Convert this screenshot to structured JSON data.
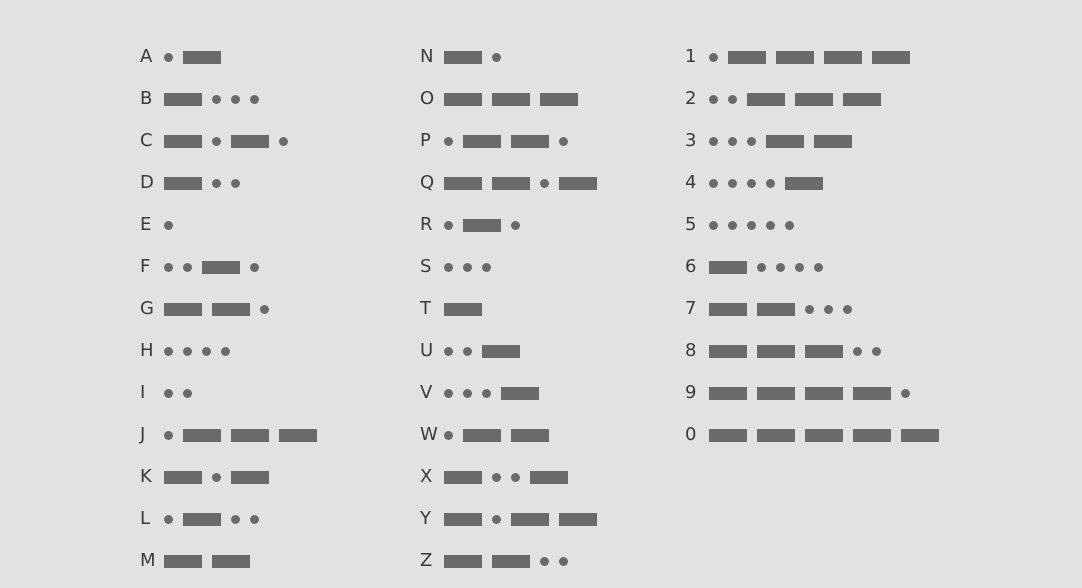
{
  "columns": [
    [
      {
        "char": "A",
        "code": ".-"
      },
      {
        "char": "B",
        "code": "-..."
      },
      {
        "char": "C",
        "code": "-.-."
      },
      {
        "char": "D",
        "code": "-.."
      },
      {
        "char": "E",
        "code": "."
      },
      {
        "char": "F",
        "code": "..-."
      },
      {
        "char": "G",
        "code": "--."
      },
      {
        "char": "H",
        "code": "...."
      },
      {
        "char": "I",
        "code": ".."
      },
      {
        "char": "J",
        "code": ".---"
      },
      {
        "char": "K",
        "code": "-.-"
      },
      {
        "char": "L",
        "code": ".-.."
      },
      {
        "char": "M",
        "code": "--"
      }
    ],
    [
      {
        "char": "N",
        "code": "-."
      },
      {
        "char": "O",
        "code": "---"
      },
      {
        "char": "P",
        "code": ".--."
      },
      {
        "char": "Q",
        "code": "--.-"
      },
      {
        "char": "R",
        "code": ".-."
      },
      {
        "char": "S",
        "code": "..."
      },
      {
        "char": "T",
        "code": "-"
      },
      {
        "char": "U",
        "code": "..-"
      },
      {
        "char": "V",
        "code": "...-"
      },
      {
        "char": "W",
        "code": ".--"
      },
      {
        "char": "X",
        "code": "-..-"
      },
      {
        "char": "Y",
        "code": "-.--"
      },
      {
        "char": "Z",
        "code": "--.."
      }
    ],
    [
      {
        "char": "1",
        "code": ".----"
      },
      {
        "char": "2",
        "code": "..---"
      },
      {
        "char": "3",
        "code": "...--"
      },
      {
        "char": "4",
        "code": "....-"
      },
      {
        "char": "5",
        "code": "....."
      },
      {
        "char": "6",
        "code": "-...."
      },
      {
        "char": "7",
        "code": "--..."
      },
      {
        "char": "8",
        "code": "---.."
      },
      {
        "char": "9",
        "code": "----."
      },
      {
        "char": "0",
        "code": "-----"
      }
    ]
  ]
}
